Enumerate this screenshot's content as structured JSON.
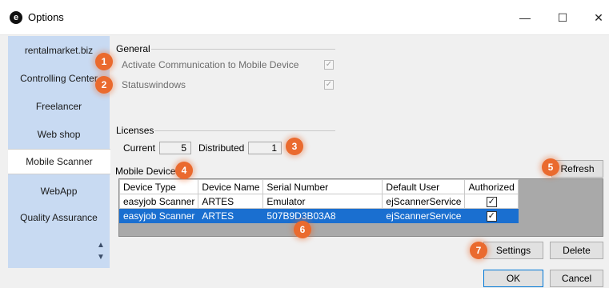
{
  "window": {
    "title": "Options",
    "app_icon_glyph": "e",
    "minimize_glyph": "—",
    "maximize_glyph": "☐",
    "close_glyph": "✕"
  },
  "sidebar": {
    "items": [
      {
        "label": "rentalmarket.biz"
      },
      {
        "label": "Controlling Center"
      },
      {
        "label": "Freelancer"
      },
      {
        "label": "Web shop"
      },
      {
        "label": "Mobile Scanner"
      },
      {
        "label": "WebApp"
      },
      {
        "label": "Quality Assurance"
      }
    ],
    "active_index": 4,
    "scroll_up_glyph": "▲",
    "scroll_down_glyph": "▼"
  },
  "general": {
    "label": "General",
    "options": [
      {
        "label": "Activate Communication to Mobile Device",
        "checked": true,
        "disabled": true
      },
      {
        "label": "Statuswindows",
        "checked": true,
        "disabled": true
      }
    ]
  },
  "licenses": {
    "label": "Licenses",
    "current_label": "Current",
    "current_value": "5",
    "distributed_label": "Distributed",
    "distributed_value": "1"
  },
  "devices": {
    "label": "Mobile Devices",
    "refresh_label": "Refresh",
    "columns": [
      "Device Type",
      "Device Name",
      "Serial Number",
      "Default User",
      "Authorized"
    ],
    "rows": [
      {
        "type": "easyjob Scanner",
        "name": "ARTES",
        "serial": "Emulator",
        "user": "ejScannerService",
        "authorized": true
      },
      {
        "type": "easyjob Scanner",
        "name": "ARTES",
        "serial": "507B9D3B03A8",
        "user": "ejScannerService",
        "authorized": true
      }
    ],
    "selected_row": 1
  },
  "buttons": {
    "settings": "Settings",
    "delete": "Delete",
    "ok": "OK",
    "cancel": "Cancel"
  },
  "badges": [
    "1",
    "2",
    "3",
    "4",
    "5",
    "6",
    "7"
  ],
  "checkmark_glyph": "✓",
  "colors": {
    "sidebar_bg": "#c8daf2",
    "badge": "#ea6a2e",
    "selection": "#1a6fd0"
  }
}
